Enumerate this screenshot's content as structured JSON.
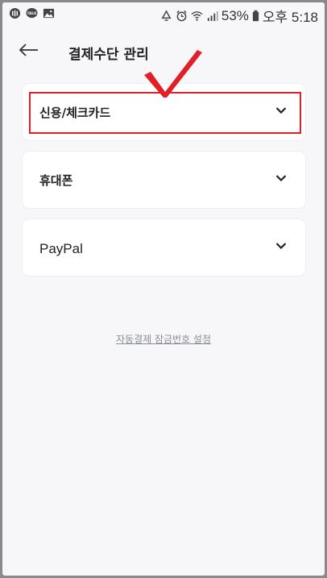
{
  "status_bar": {
    "battery_percent": "53%",
    "time": "오후 5:18",
    "icons": [
      "app-icon",
      "talk-icon",
      "gallery-icon",
      "recycle-icon",
      "alarm-icon",
      "wifi-icon",
      "signal-icon",
      "battery-icon"
    ],
    "talk_text": "TALK"
  },
  "header": {
    "back_icon": "back-arrow-icon",
    "title": "결제수단 관리"
  },
  "payment_methods": [
    {
      "label": "신용/체크카드",
      "icon": "chevron-down-icon",
      "highlighted": true
    },
    {
      "label": "휴대폰",
      "icon": "chevron-down-icon",
      "highlighted": false
    },
    {
      "label": "PayPal",
      "icon": "chevron-down-icon",
      "highlighted": false
    }
  ],
  "link": {
    "label": "자동결제 잠금번호 설정"
  },
  "colors": {
    "background": "#f7f7f9",
    "card": "#ffffff",
    "highlight": "#e21e26",
    "link": "#8a8d94"
  }
}
